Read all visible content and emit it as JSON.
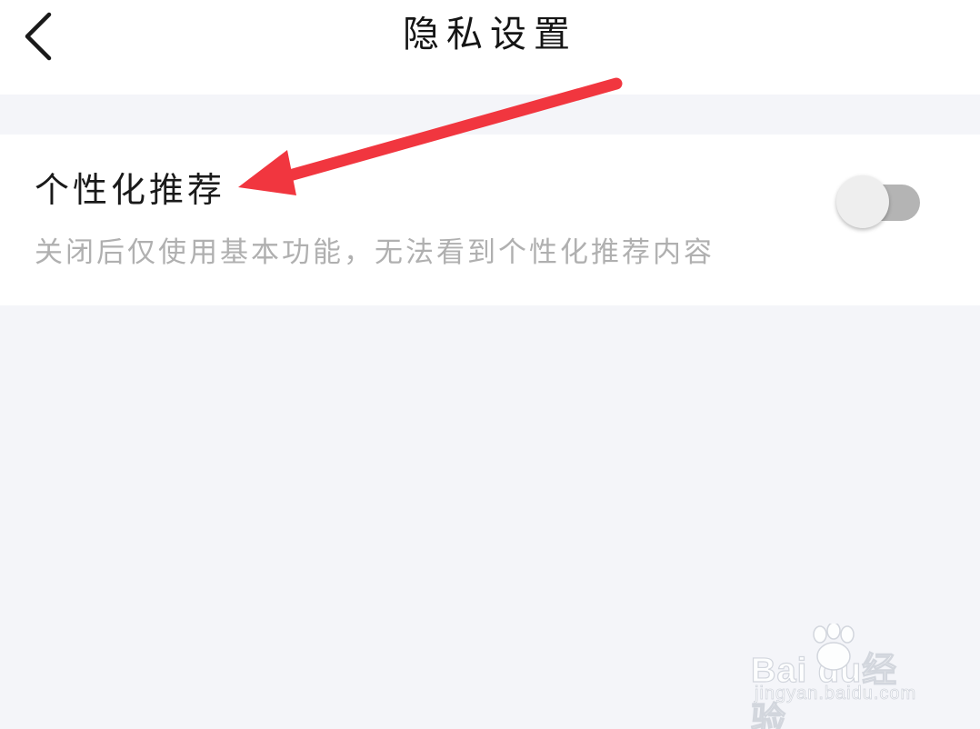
{
  "header": {
    "back_icon": "chevron-left-icon",
    "title": "隐私设置"
  },
  "settings": [
    {
      "title": "个性化推荐",
      "description": "关闭后仅使用基本功能，无法看到个性化推荐内容",
      "enabled": false
    }
  ],
  "annotation": {
    "type": "arrow",
    "color": "#f1363f"
  },
  "watermark": {
    "brand": "Bai du经验",
    "url": "jingyan.baidu.com"
  },
  "colors": {
    "background": "#f4f5f9",
    "card": "#ffffff",
    "toggle_off_track": "#b4b4b4",
    "description_text": "#b0b0b0"
  }
}
